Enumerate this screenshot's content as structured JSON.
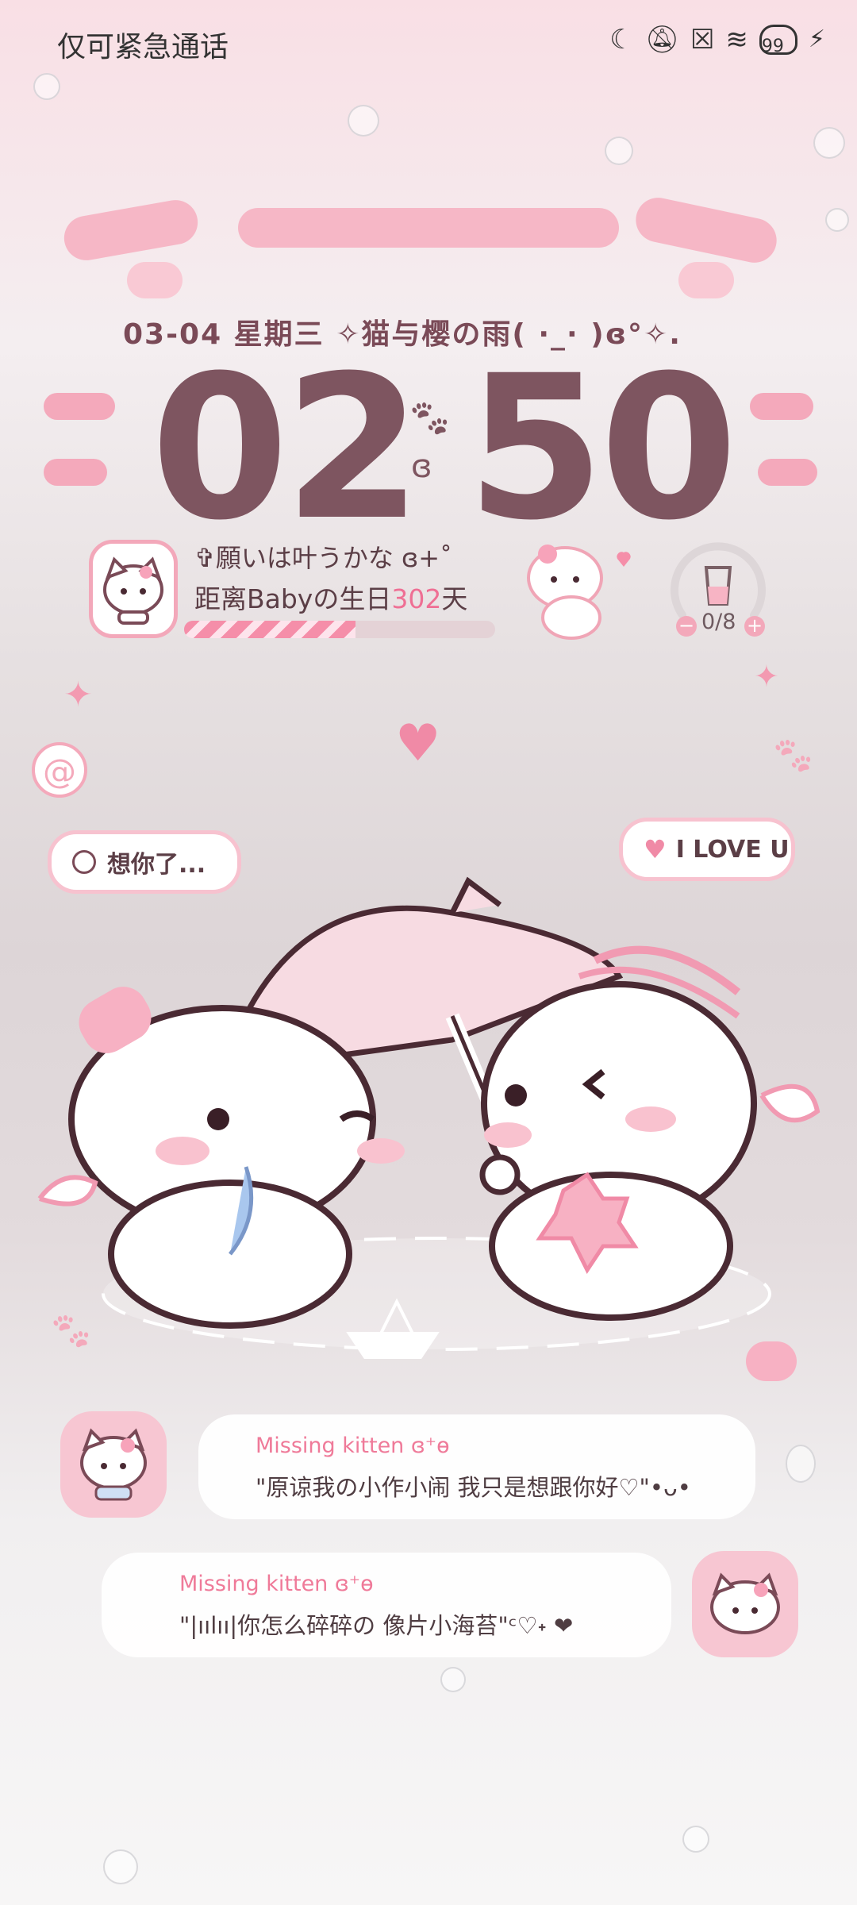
{
  "status_bar": {
    "carrier_text": "仅可紧急通话",
    "icons": [
      "moon-icon",
      "mute-icon",
      "no-sim-icon",
      "wifi-icon",
      "battery-icon",
      "charging-icon"
    ],
    "battery_level": "99"
  },
  "lockscreen": {
    "date_line": "03-04  星期三  ✧猫与樱の雨(  ·_·  )ɞ°✧.",
    "clock_hours": "02",
    "clock_minutes": "50",
    "wish_text": "✞願いは叶うかな ɞ+˚",
    "countdown_prefix": "距离Babyの生日",
    "countdown_days": "302",
    "countdown_suffix": "天",
    "countdown_progress_fraction": 0.55,
    "water_label": "0/8",
    "bubble_left": "想你了...",
    "bubble_right": "I LOVE U"
  },
  "messages": [
    {
      "name": "Missing kitten ɞ⁺ɵ",
      "text": "\"原谅我の小作小闹 我只是想跟你好♡\"•ᴗ•"
    },
    {
      "name": "Missing kitten ɞ⁺ɵ",
      "text": "\"|ıılıı|你怎么碎碎の 像片小海苔\"ᶜ♡˖ ❤"
    }
  ],
  "colors": {
    "accent_pink": "#f4a9bb",
    "clock": "#7e5560",
    "text_pink": "#ef7a99"
  }
}
